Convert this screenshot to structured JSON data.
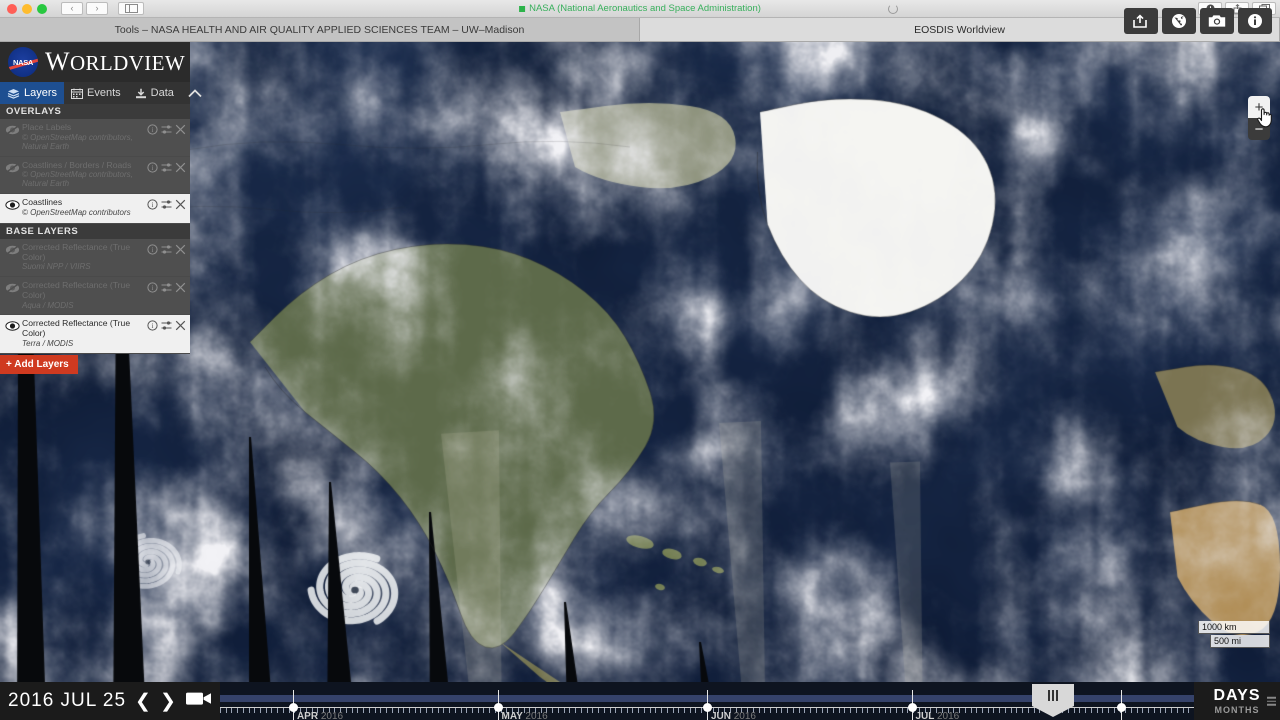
{
  "browser": {
    "url_text": "NASA (National Aeronautics and Space Administration)",
    "back_glyph": "‹",
    "forward_glyph": "›",
    "sidebar_icon": "sidebar-icon",
    "reload_icon": "reload-icon",
    "downloads_icon": "downloads-icon",
    "share_icon": "share-icon",
    "tabs_icon": "tabs-icon",
    "tabs": [
      {
        "label": "Tools – NASA HEALTH AND AIR QUALITY APPLIED SCIENCES TEAM – UW–Madison",
        "active": false
      },
      {
        "label": "EOSDIS Worldview",
        "active": true
      }
    ]
  },
  "sidebar": {
    "brand_nasa": "NASA",
    "title_cap": "W",
    "title_rest": "ORLDVIEW",
    "tabs": [
      {
        "label": "Layers",
        "icon": "layers-icon",
        "active": true
      },
      {
        "label": "Events",
        "icon": "calendar-icon",
        "active": false
      },
      {
        "label": "Data",
        "icon": "download-icon",
        "active": false
      }
    ],
    "collapse_icon": "chevron-up-icon",
    "overlays_title": "OVERLAYS",
    "base_title": "BASE LAYERS",
    "overlays": [
      {
        "name": "Place Labels",
        "sub": "© OpenStreetMap contributors, Natural Earth",
        "visible": false
      },
      {
        "name": "Coastlines / Borders / Roads",
        "sub": "© OpenStreetMap contributors, Natural Earth",
        "visible": false
      },
      {
        "name": "Coastlines",
        "sub": "© OpenStreetMap contributors",
        "visible": true
      }
    ],
    "base_layers": [
      {
        "name": "Corrected Reflectance (True Color)",
        "sub": "Suomi NPP / VIIRS",
        "visible": false
      },
      {
        "name": "Corrected Reflectance (True Color)",
        "sub": "Aqua / MODIS",
        "visible": false
      },
      {
        "name": "Corrected Reflectance (True Color)",
        "sub": "Terra / MODIS",
        "visible": true
      }
    ],
    "row_icons": {
      "info": "info-icon",
      "settings": "opacity-icon",
      "remove": "close-icon"
    },
    "add_layers_label": "+ Add Layers",
    "add_layers_color": "#cf3a20",
    "active_tab_color": "#1e4f91"
  },
  "map_toolbar": [
    {
      "name": "share-link-button",
      "icon": "share-icon"
    },
    {
      "name": "projection-button",
      "icon": "globe-icon"
    },
    {
      "name": "snapshot-button",
      "icon": "camera-icon"
    },
    {
      "name": "info-button",
      "icon": "info-icon"
    }
  ],
  "zoom_control": {
    "in_label": "+",
    "out_label": "−"
  },
  "scale": {
    "metric": "1000 km",
    "imperial": "500 mi"
  },
  "timeline": {
    "date": "2016 JUL 25",
    "prev_glyph": "❮",
    "next_glyph": "❯",
    "animate_icon": "video-camera-icon",
    "handle_icon": "drag-handle-icon",
    "zoom_primary": "DAYS",
    "zoom_secondary": "MONTHS",
    "axis_menu_icon": "menu-lines-icon",
    "months": [
      {
        "label": "APR",
        "year": "2016",
        "pos": 7.5
      },
      {
        "label": "MAY",
        "year": "2016",
        "pos": 28.5
      },
      {
        "label": "JUN",
        "year": "2016",
        "pos": 50.0
      },
      {
        "label": "JUL",
        "year": "2016",
        "pos": 71.0
      }
    ],
    "selected_pos": 92.5,
    "handle_pos": 85.5
  }
}
